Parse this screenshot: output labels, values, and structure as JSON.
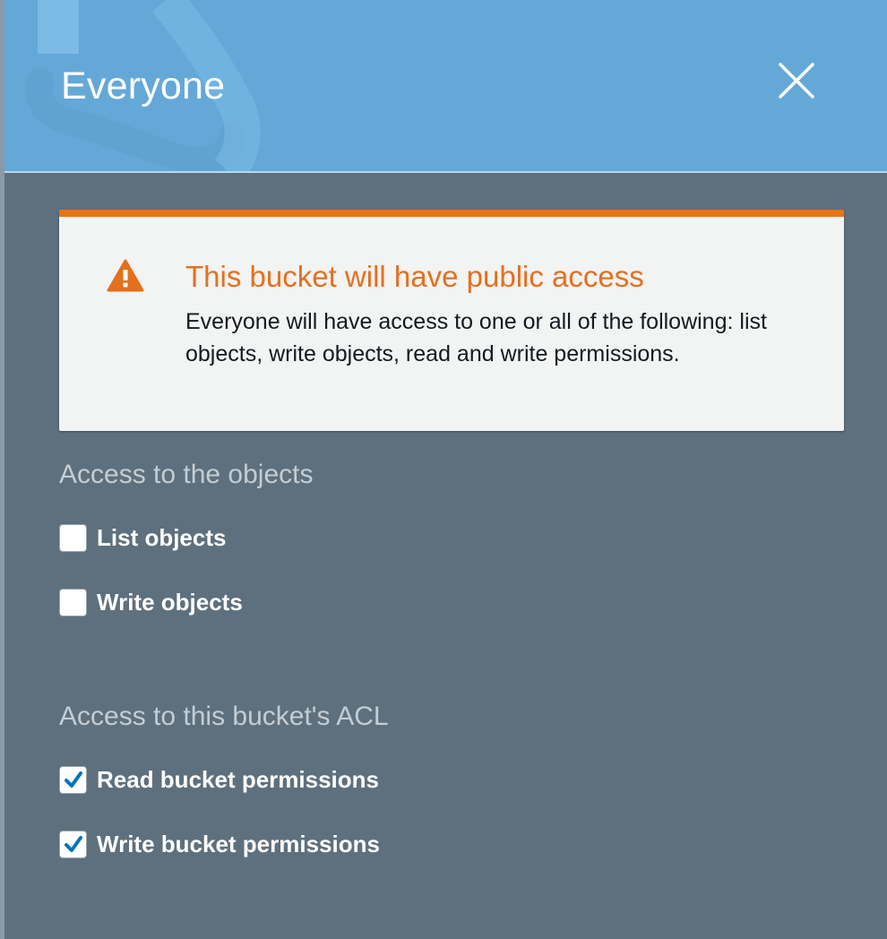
{
  "panel": {
    "title": "Everyone",
    "close_icon": "close-icon"
  },
  "alert": {
    "icon": "warning-icon",
    "title": "This bucket will have public access",
    "body": "Everyone will have access to one or all of the following: list objects, write objects, read and write permissions.",
    "accent_color": "#ec7211"
  },
  "objects_access": {
    "heading": "Access to the objects",
    "options": [
      {
        "label": "List objects",
        "checked": false
      },
      {
        "label": "Write objects",
        "checked": false
      }
    ]
  },
  "acl_access": {
    "heading": "Access to this bucket's ACL",
    "options": [
      {
        "label": "Read bucket permissions",
        "checked": true
      },
      {
        "label": "Write bucket permissions",
        "checked": true
      }
    ]
  },
  "colors": {
    "header": "#64a8d8",
    "panel_background": "#5e707d",
    "check": "#0073bb"
  }
}
